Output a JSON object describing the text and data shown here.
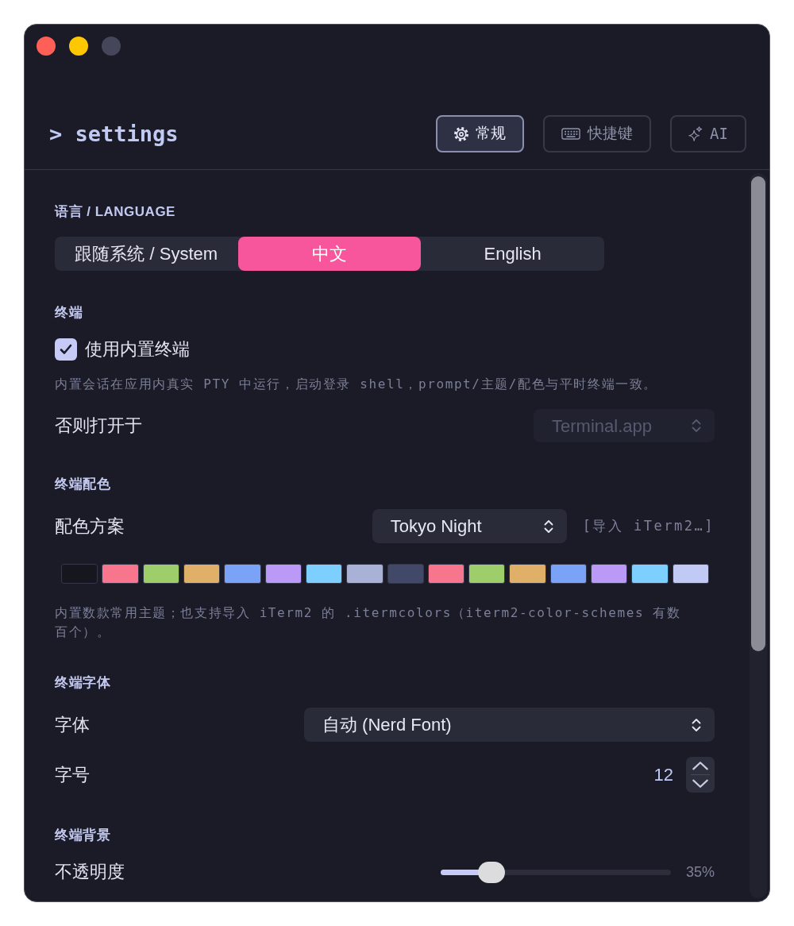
{
  "window_controls": [
    {
      "kind": "close",
      "disabled": false
    },
    {
      "kind": "minimize",
      "disabled": false
    },
    {
      "kind": "zoom",
      "disabled": true
    }
  ],
  "header": {
    "title": "> settings",
    "tabs": [
      {
        "kind": "general",
        "label": "常规",
        "selected": true
      },
      {
        "kind": "shortcuts",
        "label": "快捷键",
        "selected": false
      },
      {
        "kind": "ai",
        "label": "AI",
        "selected": false
      }
    ]
  },
  "language": {
    "heading": "语言 / LANGUAGE",
    "options": [
      {
        "label": "跟随系统 / System",
        "selected": false
      },
      {
        "label": "中文",
        "selected": true
      },
      {
        "label": "English",
        "selected": false
      }
    ]
  },
  "terminal": {
    "heading": "终端",
    "use_builtin": {
      "label": "使用内置终端",
      "checked": true
    },
    "hint": "内置会话在应用内真实 PTY 中运行，启动登录 shell，prompt/主题/配色与平时终端一致。",
    "open_with": {
      "label": "否则打开于",
      "value": "Terminal.app",
      "disabled": true
    }
  },
  "colors": {
    "heading": "终端配色",
    "scheme": {
      "label": "配色方案",
      "value": "Tokyo Night"
    },
    "import_link": "[导入 iTerm2…]",
    "swatches": [
      {
        "color": "#15161e"
      },
      {
        "color": "#f7768e"
      },
      {
        "color": "#9ece6a"
      },
      {
        "color": "#e0af68"
      },
      {
        "color": "#7aa2f7"
      },
      {
        "color": "#bb9af7"
      },
      {
        "color": "#7dcfff"
      },
      {
        "color": "#a9b1d6"
      },
      {
        "color": "#414868"
      },
      {
        "color": "#f7768e"
      },
      {
        "color": "#9ece6a"
      },
      {
        "color": "#e0af68"
      },
      {
        "color": "#7aa2f7"
      },
      {
        "color": "#bb9af7"
      },
      {
        "color": "#7dcfff"
      },
      {
        "color": "#c0caf5"
      }
    ],
    "hint": "内置数款常用主题；也支持导入 iTerm2 的 .itermcolors（iterm2-color-schemes 有数百个）。"
  },
  "font": {
    "heading": "终端字体",
    "family": {
      "label": "字体",
      "value": "自动 (Nerd Font)"
    },
    "size": {
      "label": "字号",
      "value": "12"
    }
  },
  "background": {
    "heading": "终端背景",
    "opacity": {
      "label": "不透明度",
      "level": 0.22,
      "reading": "35%"
    }
  }
}
